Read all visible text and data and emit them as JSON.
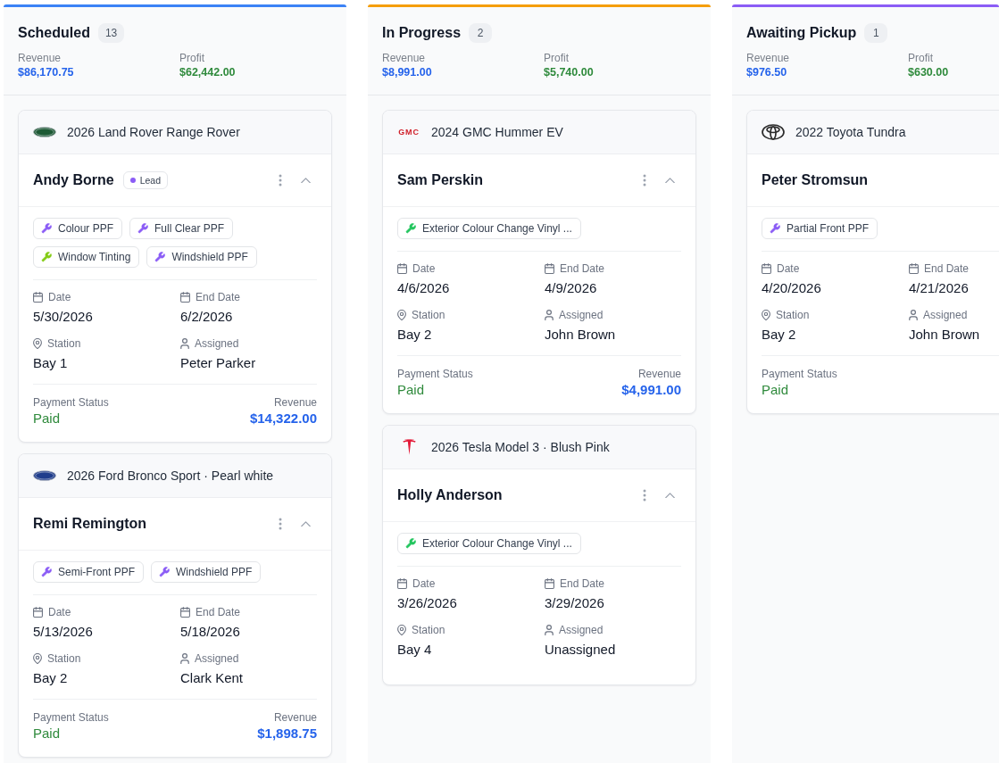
{
  "columns": [
    {
      "title": "Scheduled",
      "count": "13",
      "color": "#3b82f6",
      "stats": [
        {
          "kind": "revenue",
          "label": "Revenue",
          "value": "$86,170.75"
        },
        {
          "kind": "profit",
          "label": "Profit",
          "value": "$62,442.00"
        }
      ],
      "cards": [
        {
          "vehicle": "2026 Land Rover Range Rover",
          "logo": {
            "kind": "oval",
            "color": "#1d5a34"
          },
          "customer": "Andy Borne",
          "badge": {
            "label": "Lead",
            "color": "#8b5cf6"
          },
          "actions": true,
          "services": [
            {
              "label": "Colour PPF",
              "color": "#8b5cf6"
            },
            {
              "label": "Full Clear PPF",
              "color": "#8b5cf6"
            },
            {
              "label": "Window Tinting",
              "color": "#84cc16"
            },
            {
              "label": "Windshield PPF",
              "color": "#8b5cf6"
            }
          ],
          "fields": [
            {
              "kind": "date",
              "label": "Date",
              "value": "5/30/2026"
            },
            {
              "kind": "date",
              "label": "End Date",
              "value": "6/2/2026"
            },
            {
              "kind": "place",
              "label": "Station",
              "value": "Bay 1"
            },
            {
              "kind": "person",
              "label": "Assigned",
              "value": "Peter Parker"
            }
          ],
          "payment": {
            "label": "Payment Status",
            "status": "Paid",
            "revenue_label": "Revenue",
            "revenue": "$14,322.00"
          }
        },
        {
          "vehicle": "2026 Ford Bronco Sport · Pearl white",
          "logo": {
            "kind": "oval",
            "color": "#1f3d8c"
          },
          "customer": "Remi Remington",
          "actions": true,
          "services": [
            {
              "label": "Semi-Front PPF",
              "color": "#8b5cf6"
            },
            {
              "label": "Windshield PPF",
              "color": "#8b5cf6"
            }
          ],
          "fields": [
            {
              "kind": "date",
              "label": "Date",
              "value": "5/13/2026"
            },
            {
              "kind": "date",
              "label": "End Date",
              "value": "5/18/2026"
            },
            {
              "kind": "place",
              "label": "Station",
              "value": "Bay 2"
            },
            {
              "kind": "person",
              "label": "Assigned",
              "value": "Clark Kent"
            }
          ],
          "payment": {
            "label": "Payment Status",
            "status": "Paid",
            "revenue_label": "Revenue",
            "revenue": "$1,898.75"
          }
        }
      ]
    },
    {
      "title": "In Progress",
      "count": "2",
      "color": "#f59e0b",
      "stats": [
        {
          "kind": "revenue",
          "label": "Revenue",
          "value": "$8,991.00"
        },
        {
          "kind": "profit",
          "label": "Profit",
          "value": "$5,740.00"
        }
      ],
      "cards": [
        {
          "vehicle": "2024 GMC Hummer EV",
          "logo": {
            "kind": "wordmark",
            "text": "GMC",
            "color": "#d0202a"
          },
          "customer": "Sam Perskin",
          "actions": true,
          "services": [
            {
              "label": "Exterior Colour Change Vinyl ...",
              "color": "#22c55e"
            }
          ],
          "fields": [
            {
              "kind": "date",
              "label": "Date",
              "value": "4/6/2026"
            },
            {
              "kind": "date",
              "label": "End Date",
              "value": "4/9/2026"
            },
            {
              "kind": "place",
              "label": "Station",
              "value": "Bay 2"
            },
            {
              "kind": "person",
              "label": "Assigned",
              "value": "John Brown"
            }
          ],
          "payment": {
            "label": "Payment Status",
            "status": "Paid",
            "revenue_label": "Revenue",
            "revenue": "$4,991.00"
          }
        },
        {
          "vehicle": "2026 Tesla Model 3 · Blush Pink",
          "logo": {
            "kind": "tee",
            "color": "#e31937"
          },
          "customer": "Holly Anderson",
          "actions": true,
          "services": [
            {
              "label": "Exterior Colour Change Vinyl ...",
              "color": "#22c55e"
            }
          ],
          "fields": [
            {
              "kind": "date",
              "label": "Date",
              "value": "3/26/2026"
            },
            {
              "kind": "date",
              "label": "End Date",
              "value": "3/29/2026"
            },
            {
              "kind": "place",
              "label": "Station",
              "value": "Bay 4"
            },
            {
              "kind": "person",
              "label": "Assigned",
              "value": "Unassigned"
            }
          ]
        }
      ]
    },
    {
      "title": "Awaiting Pickup",
      "count": "1",
      "color": "#8b5cf6",
      "stats": [
        {
          "kind": "revenue",
          "label": "Revenue",
          "value": "$976.50"
        },
        {
          "kind": "profit",
          "label": "Profit",
          "value": "$630.00"
        }
      ],
      "cards": [
        {
          "vehicle": "2022 Toyota Tundra",
          "logo": {
            "kind": "rings",
            "color": "#2b2b2b"
          },
          "customer": "Peter Stromsun",
          "services": [
            {
              "label": "Partial Front PPF",
              "color": "#8b5cf6"
            }
          ],
          "fields": [
            {
              "kind": "date",
              "label": "Date",
              "value": "4/20/2026"
            },
            {
              "kind": "date",
              "label": "End Date",
              "value": "4/21/2026"
            },
            {
              "kind": "place",
              "label": "Station",
              "value": "Bay 2"
            },
            {
              "kind": "person",
              "label": "Assigned",
              "value": "John Brown"
            }
          ],
          "payment": {
            "label": "Payment Status",
            "status": "Paid"
          }
        }
      ]
    }
  ]
}
